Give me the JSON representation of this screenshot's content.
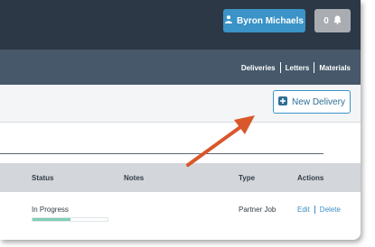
{
  "header": {
    "user_name": "Byron Michaels",
    "notification_count": "0"
  },
  "nav": {
    "links": [
      "Deliveries",
      "Letters",
      "Materials"
    ]
  },
  "toolbar": {
    "new_delivery_label": "New Delivery"
  },
  "table": {
    "columns": [
      "Status",
      "Notes",
      "Type",
      "Actions"
    ],
    "rows": [
      {
        "status": "In Progress",
        "progress_fraction": 0.5,
        "notes": "",
        "type": "Partner Job",
        "actions": [
          "Edit",
          "Delete"
        ]
      }
    ]
  },
  "colors": {
    "topbar": "#2c3846",
    "navbar": "#46586a",
    "accent": "#3b93c7",
    "progress": "#7fcfb5",
    "annotation_arrow": "#d9572b"
  },
  "icons": {
    "user": "user-icon",
    "notification": "bell-icon",
    "new_delivery": "plus-square-icon"
  }
}
